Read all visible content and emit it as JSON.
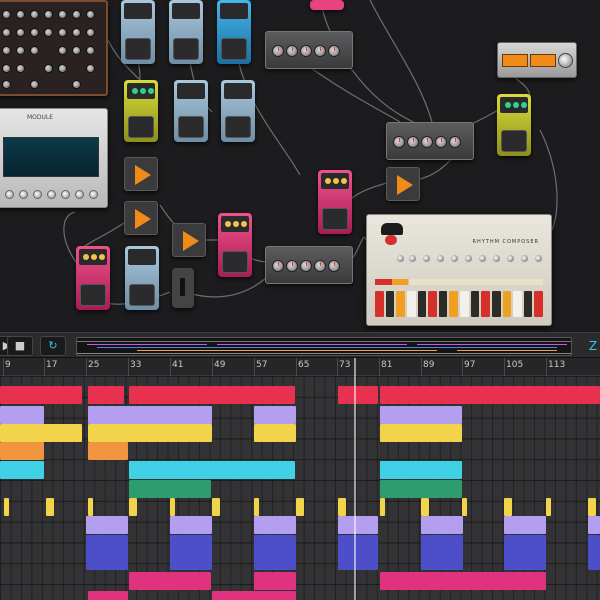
{
  "transport": {
    "play_icon": "play-icon",
    "stop_icon": "stop-icon",
    "loop_icon": "loop-icon",
    "zoom_icon": "zoom-icon"
  },
  "timeline": {
    "bar_numbers": [
      "9",
      "17",
      "25",
      "33",
      "41",
      "49",
      "57",
      "65",
      "73",
      "81",
      "89",
      "97",
      "105",
      "113"
    ]
  },
  "devices": {
    "rack_unit_brand": "MODULE",
    "drum_machine_title": "RHYTHM COMPOSER"
  },
  "colors": {
    "red": "#e8314f",
    "lavender": "#b49ef0",
    "yellow": "#f2d44b",
    "orange": "#f0953d",
    "cyan": "#3fd2e6",
    "green": "#2e9c6e",
    "blue": "#4c4fc8",
    "magenta": "#e0327e",
    "accent": "#36c5ee"
  }
}
